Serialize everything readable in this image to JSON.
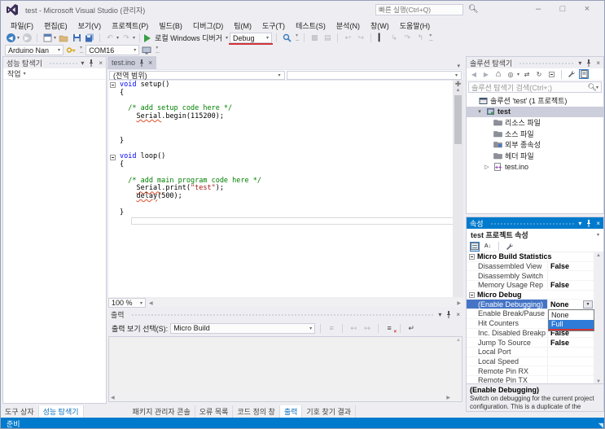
{
  "window": {
    "title": "test - Microsoft Visual Studio (관리자)",
    "quick_launch_placeholder": "빠른 실행(Ctrl+Q)",
    "controls": {
      "minimize": "–",
      "maximize": "□",
      "close": "×"
    }
  },
  "menu": {
    "items": [
      "파일(F)",
      "편집(E)",
      "보기(V)",
      "프로젝트(P)",
      "빌드(B)",
      "디버그(D)",
      "팀(M)",
      "도구(T)",
      "테스트(S)",
      "분석(N)",
      "창(W)",
      "도움말(H)"
    ]
  },
  "toolbar": {
    "debugger_label": "로컬 Windows 디버거",
    "config_value": "Debug",
    "board_value": "Arduino Nan",
    "port_value": "COM16"
  },
  "left_panel": {
    "title": "성능 탐색기",
    "actions_label": "작업"
  },
  "editor": {
    "tab_label": "test.ino",
    "scope_value": "(전역 범위)",
    "member_value": "",
    "zoom_value": "100 %",
    "code_lines": [
      {
        "o": 1,
        "s": [
          [
            "void ",
            "kw"
          ],
          [
            "setup()",
            "pl"
          ]
        ]
      },
      {
        "s": [
          [
            "{",
            "pl"
          ]
        ]
      },
      {
        "s": []
      },
      {
        "s": [
          [
            "  /* add setup code here */",
            "cm"
          ]
        ]
      },
      {
        "s": [
          [
            "    ",
            "pl"
          ],
          [
            "Serial",
            "sq"
          ],
          [
            ".begin(115200);",
            "pl"
          ]
        ]
      },
      {
        "s": []
      },
      {
        "s": []
      },
      {
        "s": [
          [
            "}",
            "pl"
          ]
        ]
      },
      {
        "s": []
      },
      {
        "o": 1,
        "s": [
          [
            "void ",
            "kw"
          ],
          [
            "loop()",
            "pl"
          ]
        ]
      },
      {
        "s": [
          [
            "{",
            "pl"
          ]
        ]
      },
      {
        "s": []
      },
      {
        "s": [
          [
            "  /* add main program code here */",
            "cm"
          ]
        ]
      },
      {
        "s": [
          [
            "    ",
            "pl"
          ],
          [
            "Serial",
            "sq"
          ],
          [
            ".print(",
            "pl"
          ],
          [
            "\"test\"",
            "str"
          ],
          [
            ");",
            "pl"
          ]
        ]
      },
      {
        "s": [
          [
            "    ",
            "pl"
          ],
          [
            "delay",
            "sq"
          ],
          [
            "(500);",
            "pl"
          ]
        ]
      },
      {
        "s": []
      },
      {
        "s": [
          [
            "}",
            "pl"
          ]
        ]
      },
      {
        "caret": 1,
        "s": []
      }
    ]
  },
  "output": {
    "title": "출력",
    "selector_label": "출력 보기 선택(S):",
    "source_value": "Micro Build"
  },
  "solution_explorer": {
    "title": "솔루션 탐색기",
    "search_placeholder": "솔루션 탐색기 검색(Ctrl+;)",
    "tree": [
      {
        "label": "솔루션 'test' (1 프로젝트)",
        "icon": "solution",
        "indent": 0
      },
      {
        "label": "test",
        "icon": "project",
        "indent": 1,
        "expander": "expanded",
        "selected": true,
        "bold": true
      },
      {
        "label": "리소스 파일",
        "icon": "folder",
        "indent": 2
      },
      {
        "label": "소스 파일",
        "icon": "folder",
        "indent": 2
      },
      {
        "label": "외부 종속성",
        "icon": "folder-deps",
        "indent": 2
      },
      {
        "label": "헤더 파일",
        "icon": "folder",
        "indent": 2
      },
      {
        "label": "test.ino",
        "icon": "ino-file",
        "indent": 2,
        "expander": "collapsed"
      }
    ]
  },
  "properties": {
    "title": "속성",
    "object_value": "test 프로젝트 속성",
    "rows": [
      {
        "label": "Micro Build Statistics",
        "value": "",
        "category": true
      },
      {
        "label": "Disassembled View",
        "value": "False"
      },
      {
        "label": "Disassembly Switch",
        "value": ""
      },
      {
        "label": "Memory Usage Rep",
        "value": "False"
      },
      {
        "label": "Micro Debug",
        "value": "",
        "category": true
      },
      {
        "label": "(Enable Debugging)",
        "value": "None",
        "selected": true,
        "dropdown": true
      },
      {
        "label": "Enable Break/Pause",
        "value": ""
      },
      {
        "label": "Hit Counters",
        "value": ""
      },
      {
        "label": "Inc. Disabled Breakp",
        "value": "False"
      },
      {
        "label": "Jump To Source",
        "value": "False"
      },
      {
        "label": "Local Port",
        "value": ""
      },
      {
        "label": "Local Speed",
        "value": ""
      },
      {
        "label": "Remote Pin RX",
        "value": ""
      },
      {
        "label": "Remote Pin TX",
        "value": ""
      }
    ],
    "dropdown_popup": {
      "options": [
        "None",
        "Full"
      ],
      "highlighted": "Full"
    },
    "description_title": "(Enable Debugging)",
    "description_text": "Switch on debugging for the current project configuration. This is a duplicate of the (Mic..."
  },
  "bottom_tabs": {
    "left": [
      {
        "label": "도구 상자",
        "active": false
      },
      {
        "label": "성능 탐색기",
        "active": true
      }
    ],
    "center": [
      {
        "label": "패키지 관리자 콘솔",
        "active": false
      },
      {
        "label": "오류 목록",
        "active": false
      },
      {
        "label": "코드 정의 창",
        "active": false
      },
      {
        "label": "출력",
        "active": true
      },
      {
        "label": "기호 찾기 결과",
        "active": false
      }
    ]
  },
  "status_bar": {
    "text": "준비"
  },
  "colors": {
    "accent_blue": "#007ACC",
    "annotation_red": "#D13438",
    "selection_blue": "#4574C6",
    "popup_highlight": "#2E7CD8",
    "chrome": "#EEEEF2"
  }
}
